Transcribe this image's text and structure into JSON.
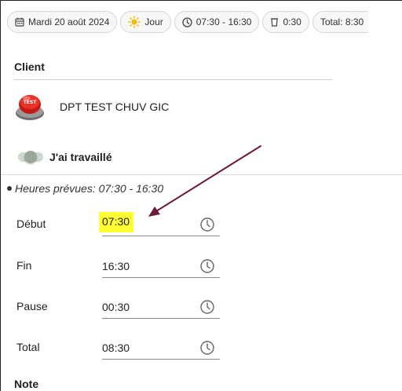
{
  "header_chips": {
    "date": "Mardi 20 août 2024",
    "shift": "Jour",
    "hours": "07:30 - 16:30",
    "break": "0:30",
    "total": "Total: 8:30"
  },
  "client": {
    "section_title": "Client",
    "logo_text": "TEST",
    "name": "DPT TEST CHUV GIC"
  },
  "worked_toggle": {
    "label": "J'ai travaillé"
  },
  "planned_hours": "Heures prévues: 07:30 - 16:30",
  "times": {
    "start": {
      "label": "Début",
      "value": "07:30"
    },
    "end": {
      "label": "Fin",
      "value": "16:30"
    },
    "pause": {
      "label": "Pause",
      "value": "00:30"
    },
    "total": {
      "label": "Total",
      "value": "08:30"
    }
  },
  "note": {
    "section_title": "Note"
  },
  "colors": {
    "highlight": "#ffff33",
    "arrow": "#6b1a3a",
    "sun": "#f5b800",
    "logo_red": "#d9251d"
  }
}
